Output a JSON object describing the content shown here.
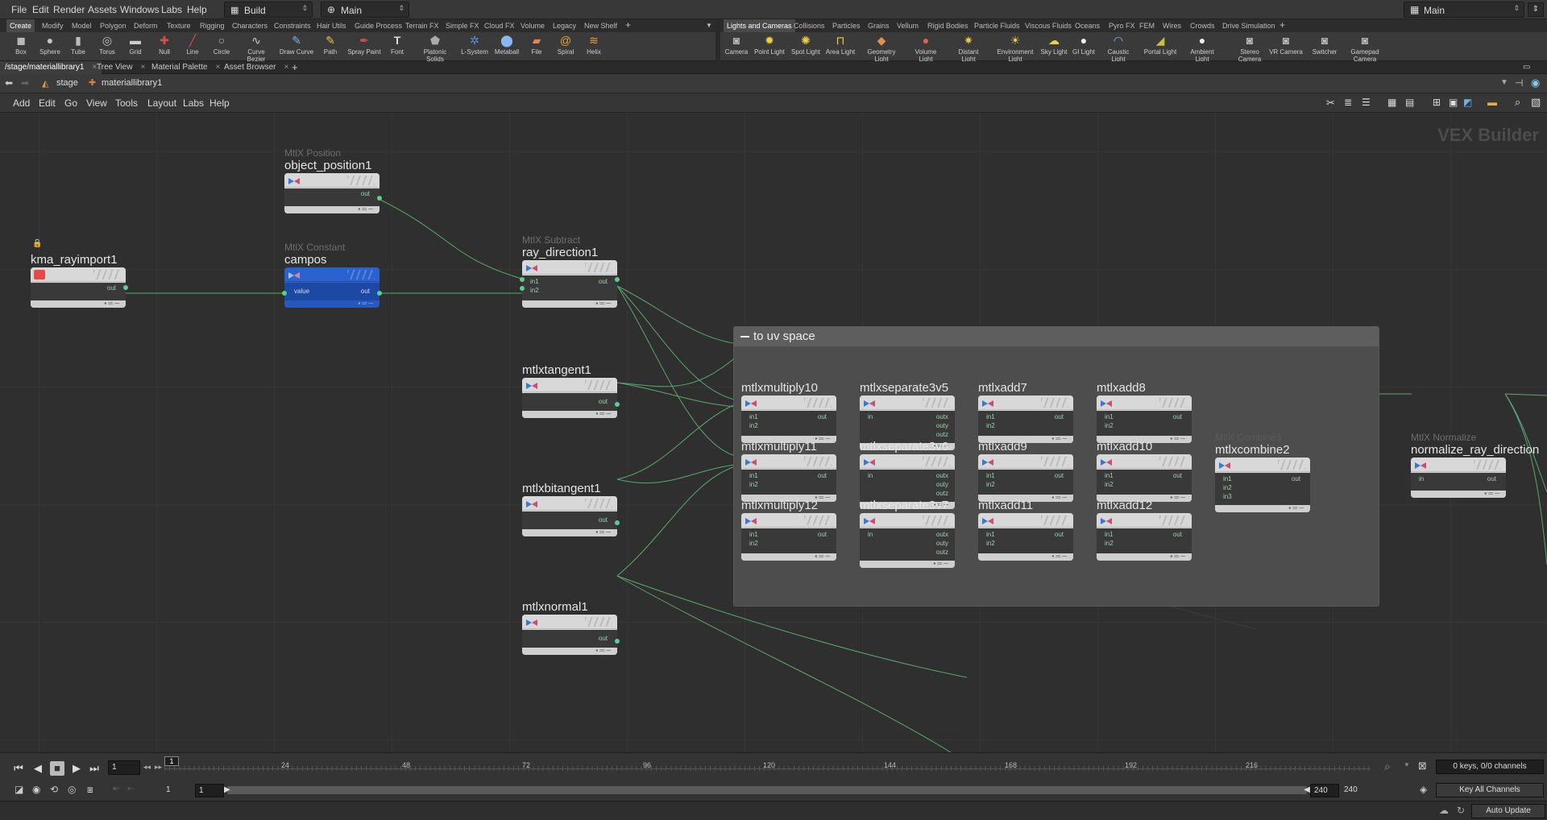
{
  "menubar": {
    "items": [
      "File",
      "Edit",
      "Render",
      "Assets",
      "Windows",
      "Labs",
      "Help"
    ],
    "desktop": "Build",
    "network_context": "Main",
    "right_desktop": "Main"
  },
  "shelf_left": {
    "tabs": [
      "Create",
      "Modify",
      "Model",
      "Polygon",
      "Deform",
      "Texture",
      "Rigging",
      "Characters",
      "Constraints",
      "Hair Utils",
      "Guide Process",
      "Terrain FX",
      "Simple FX",
      "Cloud FX",
      "Volume",
      "Legacy",
      "New Shelf"
    ],
    "active_tab": "Create",
    "tools": [
      "Box",
      "Sphere",
      "Tube",
      "Torus",
      "Grid",
      "Null",
      "Line",
      "Circle",
      "Curve Bezier",
      "Draw Curve",
      "Path",
      "Spray Paint",
      "Font",
      "Platonic Solids",
      "L-System",
      "Metaball",
      "File",
      "Spiral",
      "Helix"
    ]
  },
  "shelf_right": {
    "tabs": [
      "Lights and Cameras",
      "Collisions",
      "Particles",
      "Grains",
      "Vellum",
      "Rigid Bodies",
      "Particle Fluids",
      "Viscous Fluids",
      "Oceans",
      "Pyro FX",
      "FEM",
      "Wires",
      "Crowds",
      "Drive Simulation"
    ],
    "active_tab": "Lights and Cameras",
    "tools": [
      "Camera",
      "Point Light",
      "Spot Light",
      "Area Light",
      "Geometry Light",
      "Volume Light",
      "Distant Light",
      "Environment Light",
      "Sky Light",
      "GI Light",
      "Caustic Light",
      "Portal Light",
      "Ambient Light",
      "Stereo Camera",
      "VR Camera",
      "Switcher",
      "Gamepad Camera"
    ]
  },
  "pane_tabs": [
    "/stage/materiallibrary1",
    "Tree View",
    "Material Palette",
    "Asset Browser"
  ],
  "nav": {
    "stage": "stage",
    "node": "materiallibrary1"
  },
  "network_menu": [
    "Add",
    "Edit",
    "Go",
    "View",
    "Tools",
    "Layout",
    "Labs",
    "Help"
  ],
  "context_label": "VEX Builder",
  "network_box": {
    "title": "to uv space"
  },
  "nodes": {
    "kma_rayimport1": {
      "name": "kma_rayimport1",
      "type": ""
    },
    "object_position1": {
      "name": "object_position1",
      "type": "MtlX Position"
    },
    "campos": {
      "name": "campos",
      "type": "MtlX Constant"
    },
    "ray_direction1": {
      "name": "ray_direction1",
      "type": "MtlX Subtract"
    },
    "mtlxtangent1": {
      "name": "mtlxtangent1",
      "type": ""
    },
    "mtlxbitangent1": {
      "name": "mtlxbitangent1",
      "type": ""
    },
    "mtlxnormal1": {
      "name": "mtlxnormal1",
      "type": ""
    },
    "mtlxmultiply10": {
      "name": "mtlxmultiply10"
    },
    "mtlxmultiply11": {
      "name": "mtlxmultiply11"
    },
    "mtlxmultiply12": {
      "name": "mtlxmultiply12"
    },
    "mtlxseparate3v5": {
      "name": "mtlxseparate3v5"
    },
    "mtlxseparate3v6": {
      "name": "mtlxseparate3v6"
    },
    "mtlxseparate3v7": {
      "name": "mtlxseparate3v7"
    },
    "mtlxadd7": {
      "name": "mtlxadd7"
    },
    "mtlxadd8": {
      "name": "mtlxadd8"
    },
    "mtlxadd9": {
      "name": "mtlxadd9"
    },
    "mtlxadd10": {
      "name": "mtlxadd10"
    },
    "mtlxadd11": {
      "name": "mtlxadd11"
    },
    "mtlxadd12": {
      "name": "mtlxadd12"
    },
    "mtlxcombine2": {
      "name": "mtlxcombine2",
      "type": "MtlX Combine3"
    },
    "normalize_ray_direction": {
      "name": "normalize_ray_direction",
      "type": "MtlX Normalize"
    }
  },
  "ports": {
    "out": "out",
    "in": "in",
    "in1": "in1",
    "in2": "in2",
    "in3": "in3",
    "value": "value",
    "outx": "outx",
    "outy": "outy",
    "outz": "outz"
  },
  "playbar": {
    "current_frame": "1",
    "ticks": [
      "24",
      "48",
      "72",
      "96",
      "120",
      "144",
      "168",
      "192",
      "216"
    ],
    "range_start": "1",
    "range_start2": "1",
    "range_end": "240",
    "range_end2": "240",
    "marker": "1"
  },
  "channels": {
    "keys": "0 keys, 0/0 channels",
    "key_all": "Key All Channels"
  },
  "status": {
    "auto_update": "Auto Update"
  }
}
